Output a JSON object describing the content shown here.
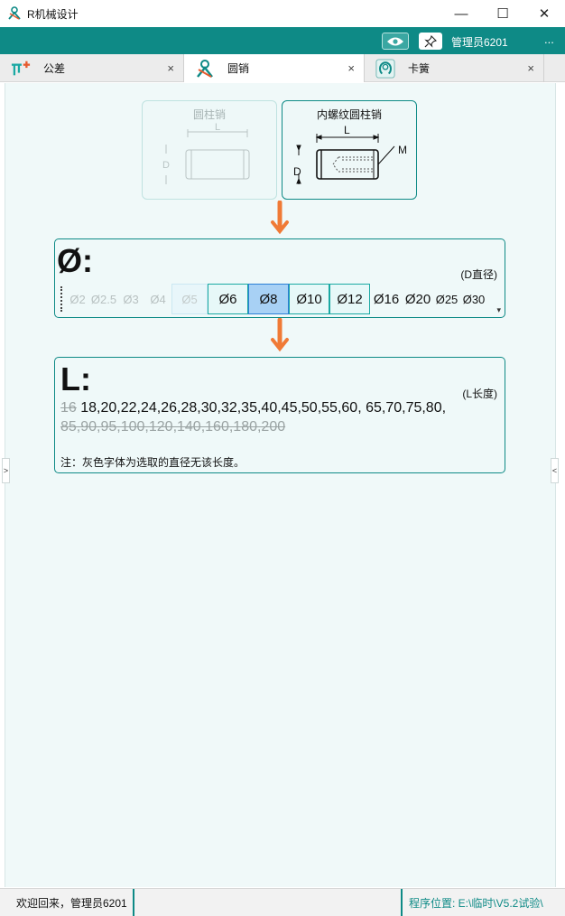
{
  "window": {
    "title": "R机械设计",
    "minimize_glyph": "—",
    "maximize_glyph": "☐",
    "close_glyph": "✕"
  },
  "topbar": {
    "user_name": "管理员6201",
    "more_glyph": "...",
    "colors": {
      "bar": "#0e8a86"
    }
  },
  "tabs": [
    {
      "label": "公差",
      "icon": "tolerance-icon",
      "close": "×",
      "active": false
    },
    {
      "label": "圆销",
      "icon": "pin-logo-icon",
      "close": "×",
      "active": true
    },
    {
      "label": "卡簧",
      "icon": "circlip-icon",
      "close": "×",
      "active": false
    }
  ],
  "pin_types": [
    {
      "caption": "圆柱销",
      "dim_l": "L",
      "dim_d": "D",
      "enabled": false
    },
    {
      "caption": "内螺纹圆柱销",
      "dim_l": "L",
      "dim_d": "D",
      "dim_m": "M",
      "enabled": true
    }
  ],
  "diameter": {
    "label": "Ø:",
    "hint": "(D直径)",
    "options": [
      {
        "text": "Ø2",
        "state": "disabled"
      },
      {
        "text": "Ø2.5",
        "state": "disabled"
      },
      {
        "text": "Ø3",
        "state": "disabled"
      },
      {
        "text": "Ø4",
        "state": "disabled"
      },
      {
        "text": "Ø5",
        "state": "disabled-boxed"
      },
      {
        "text": "Ø6",
        "state": "available"
      },
      {
        "text": "Ø8",
        "state": "selected"
      },
      {
        "text": "Ø10",
        "state": "available"
      },
      {
        "text": "Ø12",
        "state": "available"
      },
      {
        "text": "Ø16",
        "state": "plain"
      },
      {
        "text": "Ø20",
        "state": "plain"
      },
      {
        "text": "Ø25",
        "state": "small"
      },
      {
        "text": "Ø30",
        "state": "small"
      }
    ],
    "scroll_glyph": "▾"
  },
  "length": {
    "label": "L:",
    "hint": "(L长度)",
    "line1_struck": "16",
    "line1_available": " 18,20,22,24,26,28,30,32,35,40,45,50,55,60, 65,70,75,80,",
    "line2_struck": "85,90,95,100,120,140,160,180,200",
    "note": "注：灰色字体为选取的直径无该长度。"
  },
  "side_handles": {
    "left": ">",
    "right": "<"
  },
  "statusbar": {
    "welcome": "欢迎回来，管理员6201",
    "path": "程序位置: E:\\临时\\V5.2试验\\"
  }
}
